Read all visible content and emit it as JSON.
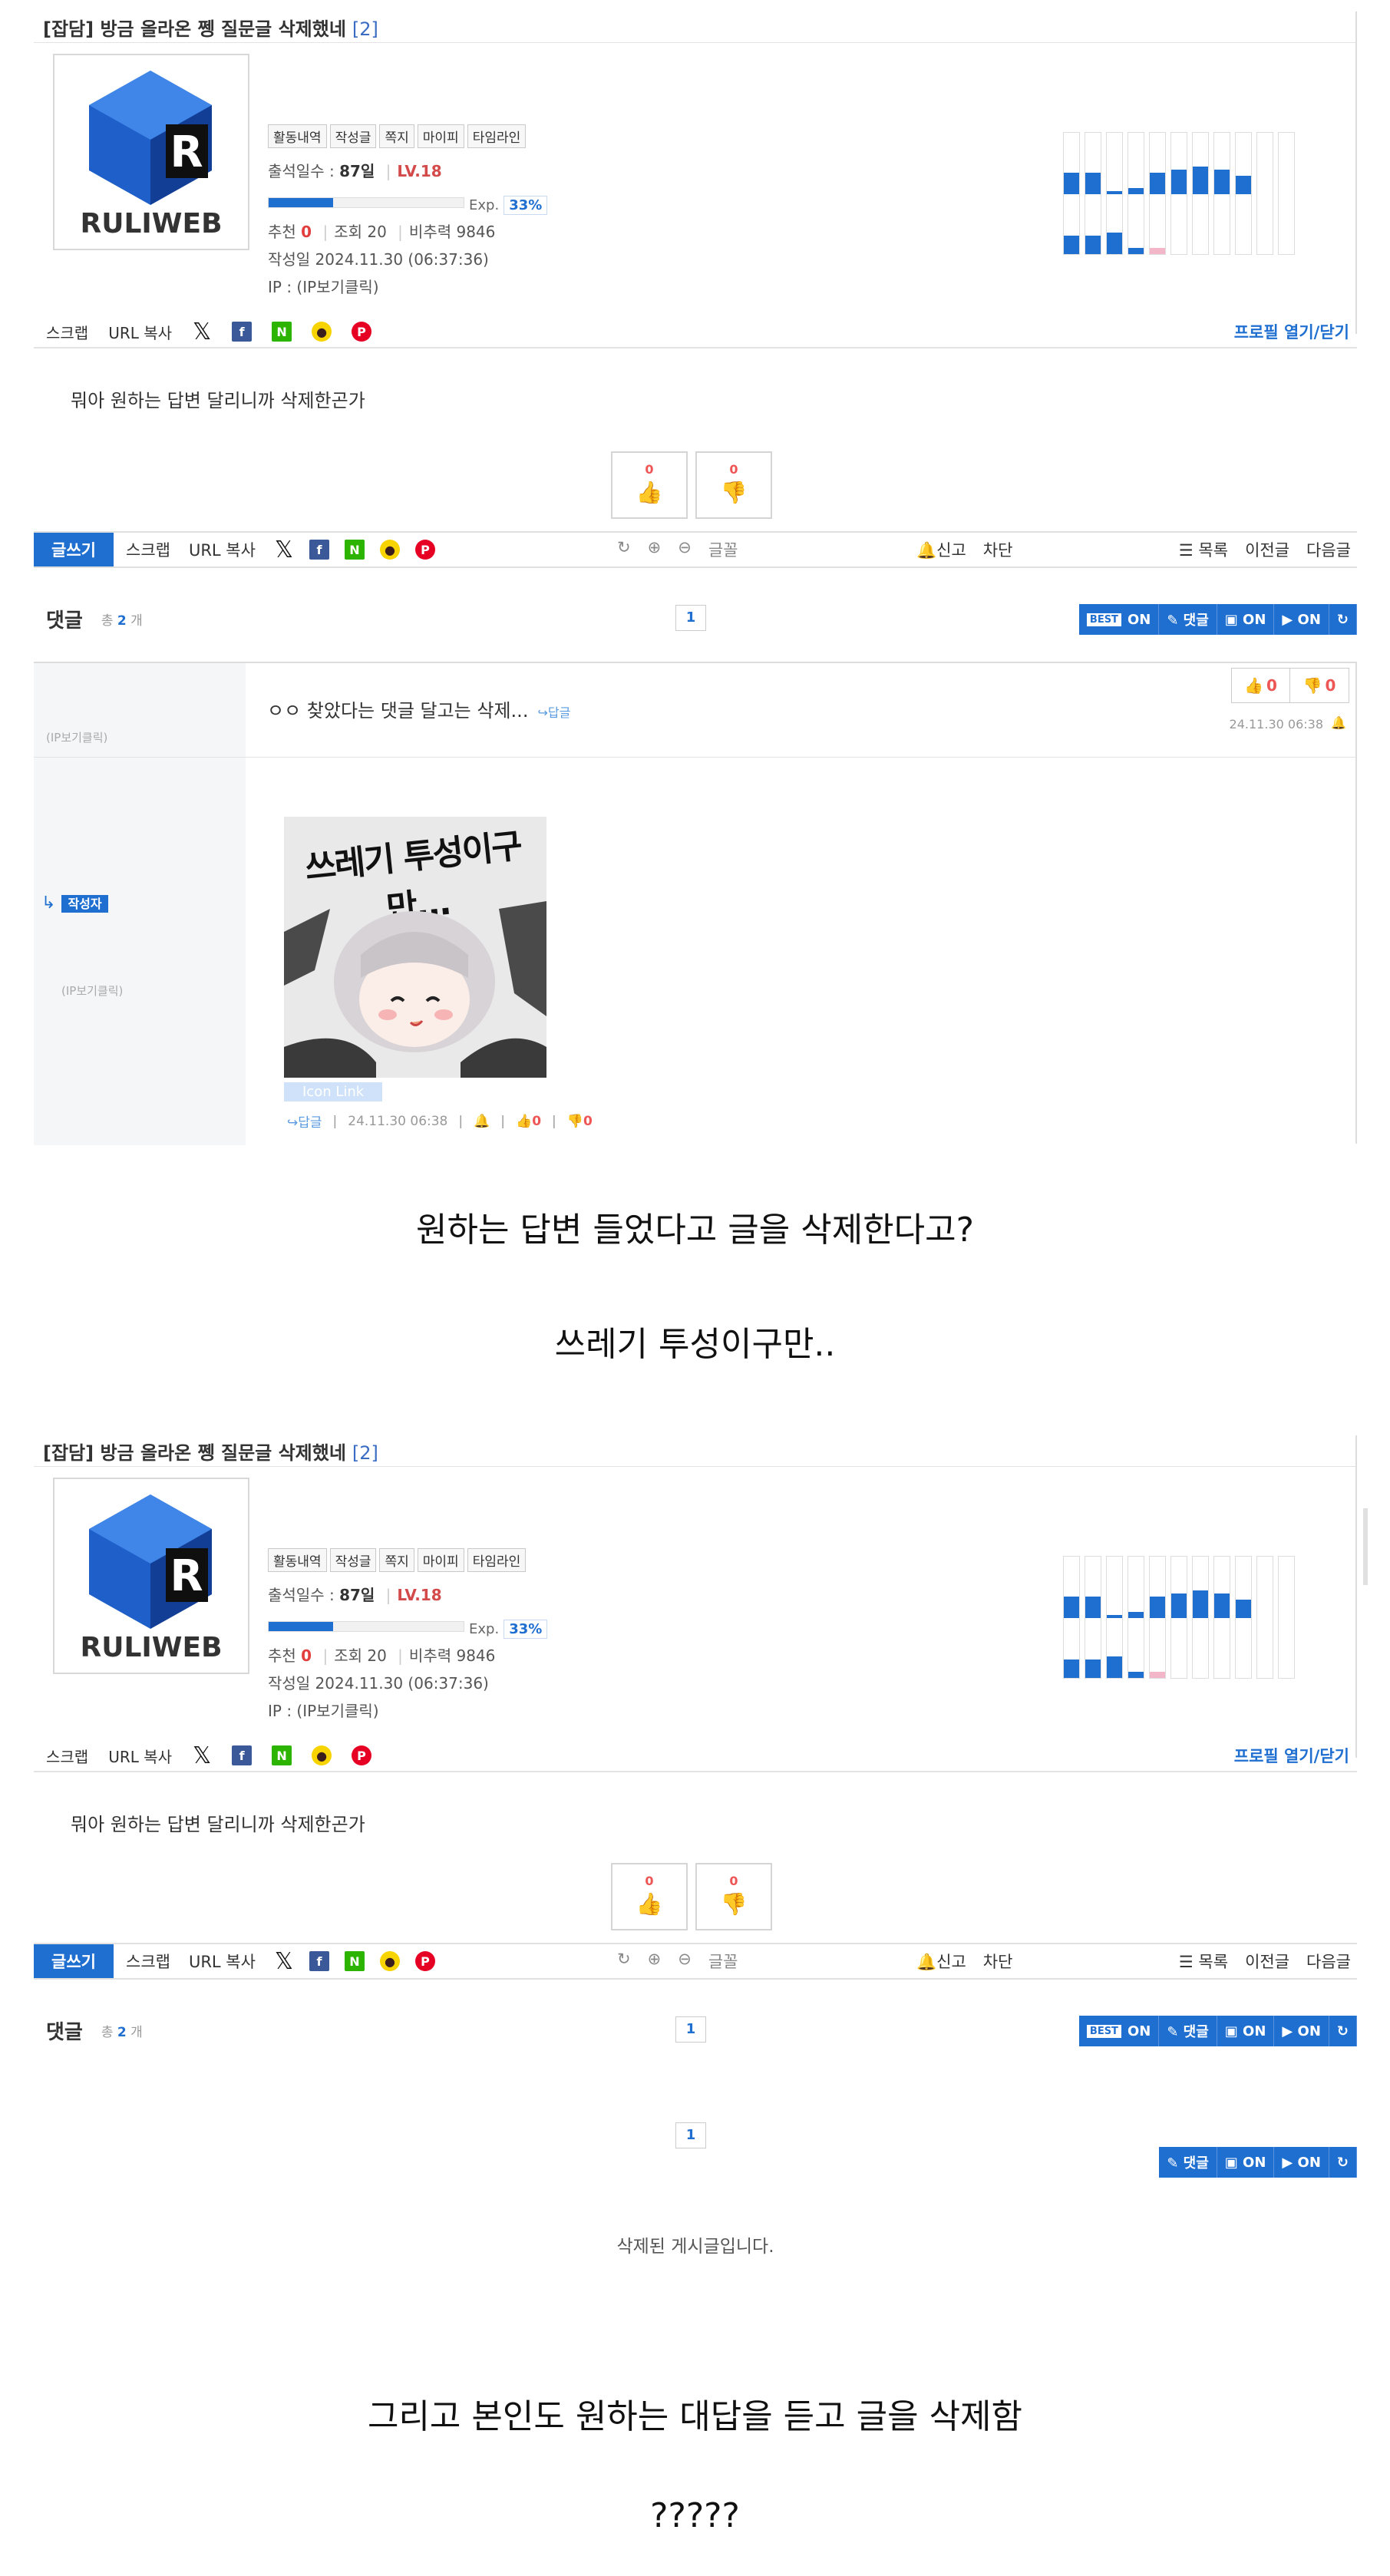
{
  "post": {
    "title": "[잡담] 방금 올라온 쩽 질문글 삭제했네",
    "comment_count": "[2]",
    "logo_text": "RULIWEB",
    "profile_tabs": [
      "활동내역",
      "작성글",
      "쪽지",
      "마이피",
      "타임라인"
    ],
    "attendance_label": "출석일수 :",
    "attendance_value": "87일",
    "level": "LV.18",
    "exp_label": "Exp.",
    "exp_pct": "33%",
    "exp_fraction": 0.33,
    "recommend_label": "추천",
    "recommend_value": "0",
    "views_label": "조회 20",
    "nonrec_label": "비추력 9846",
    "date": "작성일 2024.11.30 (06:37:36)",
    "ip": "IP : (IP보기클릭)",
    "body": "뭐아 원하는 답변 달리니까 삭제한곤가",
    "vote_up": "0",
    "vote_down": "0"
  },
  "share": {
    "scrap": "스크랩",
    "url_copy": "URL 복사",
    "x": "𝕏",
    "fb": "f",
    "naver": "N",
    "kakao": "●",
    "pinterest": "P",
    "profile_toggle": "프로필 열기/닫기"
  },
  "toolbar": {
    "write": "글쓰기",
    "scrap": "스크랩",
    "url_copy": "URL 복사",
    "refresh": "↻",
    "zoom_in": "⊕",
    "zoom_out": "⊖",
    "font": "글꼴",
    "report": "신고",
    "block": "차단",
    "list": "목록",
    "prev": "이전글",
    "next": "다음글"
  },
  "comments": {
    "label": "댓글",
    "total_prefix": "총",
    "total_num": "2",
    "total_suffix": "개",
    "page": "1",
    "best": "BEST",
    "best_on": "ON",
    "write_comment": "✎ 댓글",
    "img_on": "▣ ON",
    "video_on": "▶ ON",
    "refresh": "↻",
    "first": {
      "ip": "(IP보기클릭)",
      "text": "ㅇㅇ 찾았다는 댓글 달고는 삭제...",
      "reply": "↪답글",
      "up": "0",
      "down": "0",
      "date": "24.11.30 06:38",
      "bell": "🔔"
    },
    "second": {
      "badge": "작성자",
      "ip": "(IP보기클릭)",
      "sticker_text": "쓰레기 투성이구만...",
      "icon_link": "Icon Link",
      "reply": "↪답글",
      "date": "24.11.30 06:38",
      "up": "0",
      "down": "0"
    },
    "deleted_notice": "삭제된 게시글입니다."
  },
  "captions": {
    "c1": "원하는 답변 들었다고 글을 삭제한다고?",
    "c2": "쓰레기 투성이구만..",
    "c3": "그리고 본인도 원하는 대답을 듣고 글을 삭제함",
    "c4": "?????"
  },
  "activity": {
    "upper": [
      0.35,
      0.35,
      0.05,
      0.1,
      0.35,
      0.4,
      0.45,
      0.4,
      0.3,
      0,
      0
    ],
    "lower": [
      0.3,
      0.3,
      0.35,
      0.1,
      0.1,
      0,
      0,
      0,
      0,
      0,
      0
    ],
    "lower_pink_index": 4,
    "color_blue": "#1f6fd1",
    "color_pink": "#f3b6c8"
  }
}
